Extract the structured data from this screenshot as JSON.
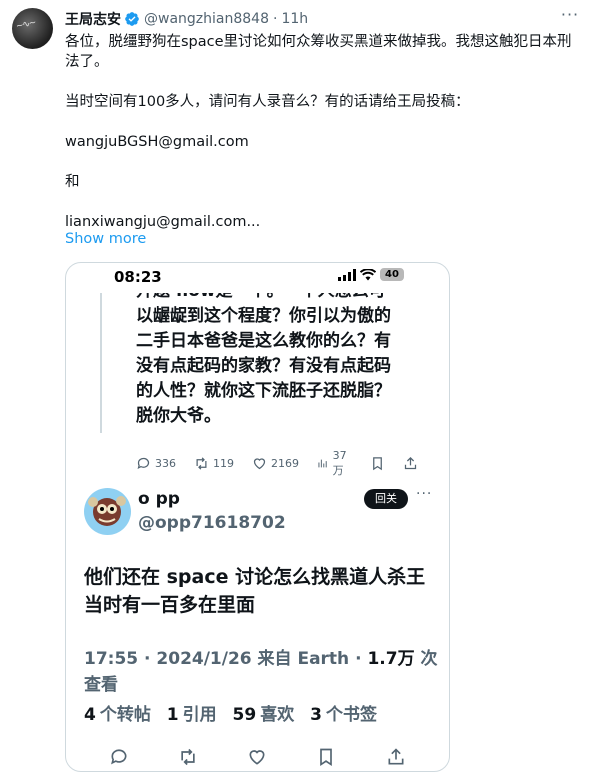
{
  "tweet": {
    "author_name": "王局志安",
    "handle": "@wangzhian8848",
    "separator": "·",
    "time": "11h",
    "paragraphs": [
      "各位，脱缰野狗在space里讨论如何众筹收买黑道来做掉我。我想这触犯日本刑法了。",
      "当时空间有100多人，请问有人录音么？有的话请给王局投稿：",
      "wangjuBGSH@gmail.com",
      "和",
      "lianxiwangju@gmail.com..."
    ],
    "show_more": "Show more"
  },
  "screenshot": {
    "status_time": "08:23",
    "battery": "40",
    "quoted_clipped": "开题 .low是一个。一个人怎么可",
    "quoted_lines": [
      "以龌龊到这个程度？你引以为傲的",
      "二手日本爸爸是这么教你的么？有",
      "没有点起码的家教？有没有点起码",
      "的人性？就你这下流胚子还脱脂？",
      "脱你大爷。"
    ],
    "quoted_actions": {
      "replies": "336",
      "reposts": "119",
      "likes": "2169",
      "views": "37万"
    },
    "reply": {
      "name": "o pp",
      "handle": "@opp71618702",
      "follow_back": "回关",
      "text": "他们还在 space 讨论怎么找黑道人杀王 当时有一百多在里面",
      "meta_time": "17:55 · 2024/1/26 来自 Earth · ",
      "meta_views": "1.7万",
      "meta_views_label": " 次查看",
      "stats": [
        {
          "n": "4",
          "label": "个转帖"
        },
        {
          "n": "1",
          "label": "引用"
        },
        {
          "n": "59",
          "label": "喜欢"
        },
        {
          "n": "3",
          "label": "个书签"
        }
      ]
    }
  },
  "colors": {
    "accent": "#1d9bf0",
    "secondary_text": "#536471",
    "border": "#cfd9de"
  }
}
